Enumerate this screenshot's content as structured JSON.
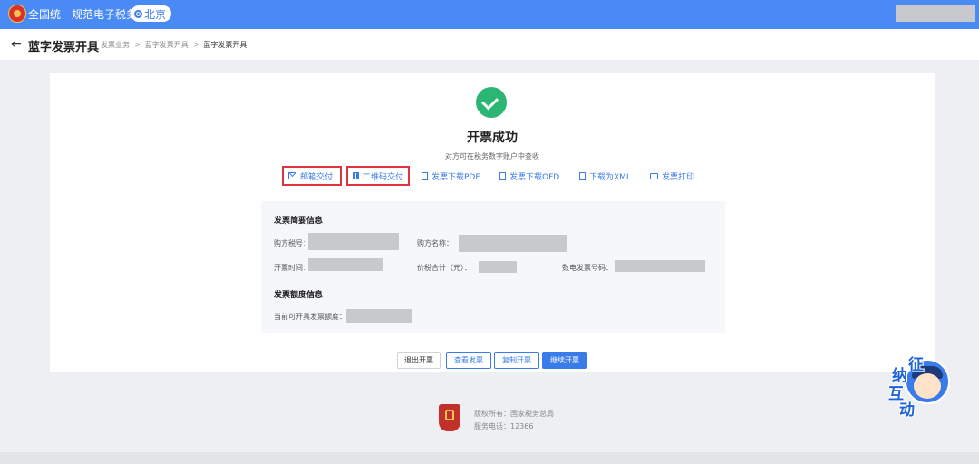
{
  "header": {
    "brand": "全国统一规范电子税务局",
    "region": "北京"
  },
  "page": {
    "title": "蓝字发票开具",
    "breadcrumb": [
      "发票业务",
      "蓝字发票开具",
      "蓝字发票开具"
    ]
  },
  "result": {
    "title": "开票成功",
    "subtitle": "对方可在税务数字账户中查收",
    "actions": [
      {
        "label": "邮箱交付",
        "icon": "mail-icon"
      },
      {
        "label": "二维码交付",
        "icon": "qrcode-icon"
      },
      {
        "label": "发票下载PDF",
        "icon": "pdf-icon"
      },
      {
        "label": "发票下载OFD",
        "icon": "ofd-icon"
      },
      {
        "label": "下载为XML",
        "icon": "xml-icon"
      },
      {
        "label": "发票打印",
        "icon": "print-icon"
      }
    ]
  },
  "summary": {
    "title": "发票简要信息",
    "buyer_tax_id_label": "购方税号：",
    "buyer_name_label": "购方名称：",
    "issue_time_label": "开票时间：",
    "total_label": "价税合计（元）：",
    "invoice_no_label": "数电发票号码："
  },
  "quota": {
    "title": "发票额度信息",
    "available_label": "当前可开具发票额度："
  },
  "buttons": {
    "exit": "退出开票",
    "view": "查看发票",
    "copy": "复制开票",
    "continue": "继续开票"
  },
  "footer": {
    "copyright": "版权所有：国家税务总局",
    "phone": "服务电话：12366"
  },
  "widget": {
    "chars": [
      "征",
      "纳",
      "互",
      "动"
    ]
  },
  "colors": {
    "primary": "#4a8af4",
    "success": "#2bb673",
    "highlight": "#e1333f"
  }
}
